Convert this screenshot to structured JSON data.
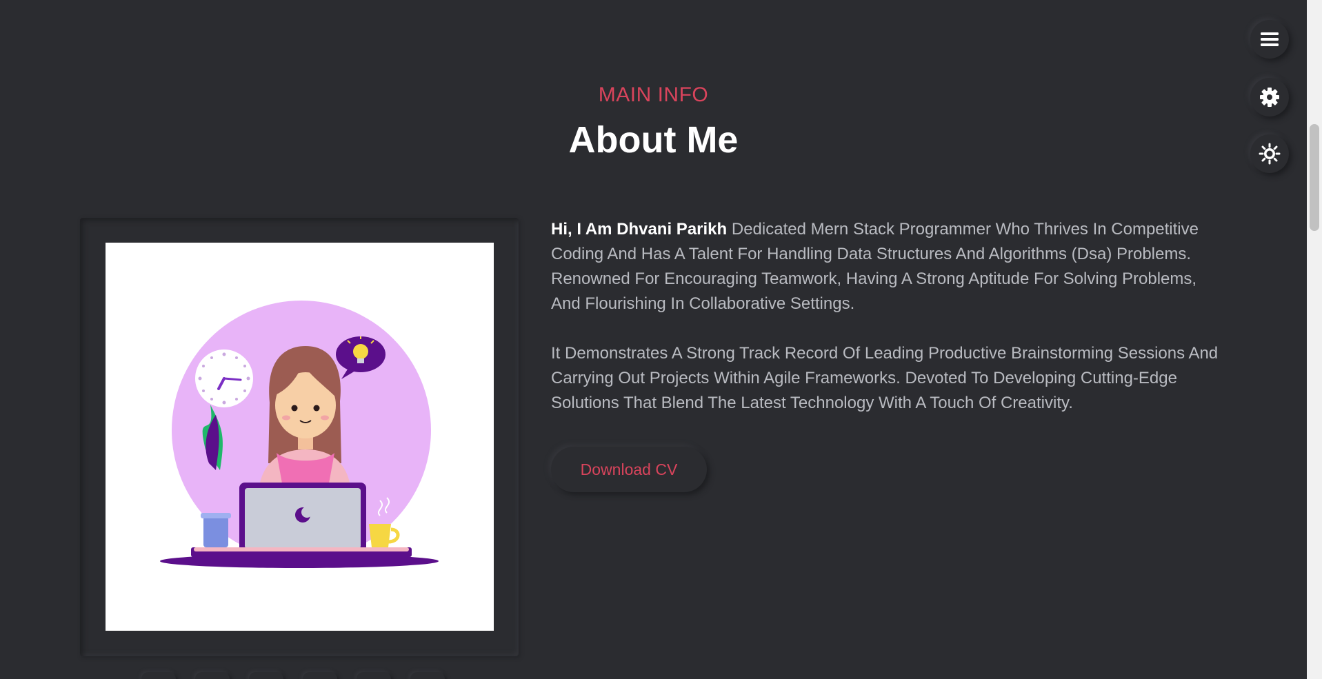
{
  "section": {
    "kicker": "MAIN INFO",
    "title": "About Me"
  },
  "about": {
    "intro_name": "Hi, I Am Dhvani Parikh",
    "intro_text": " Dedicated Mern Stack Programmer Who Thrives In Competitive Coding And Has A Talent For Handling Data Structures And Algorithms (Dsa) Problems. Renowned For Encouraging Teamwork, Having A Strong Aptitude For Solving Problems, And Flourishing In Collaborative Settings.",
    "paragraph2": "It Demonstrates A Strong Track Record Of Leading Productive Brainstorming Sessions And Carrying Out Projects Within Agile Frameworks. Devoted To Developing Cutting-Edge Solutions That Blend The Latest Technology With A Touch Of Creativity.",
    "cv_button": "Download CV"
  },
  "side_controls": {
    "menu_icon": "hamburger-menu-icon",
    "settings_icon": "gear-icon",
    "theme_icon": "sun-icon"
  },
  "colors": {
    "background": "#2b2c30",
    "accent": "#d9445c",
    "text": "#b9bbc1",
    "heading": "#ffffff",
    "illustration_circle": "#e8b4f8",
    "laptop": "#c9ccd8",
    "purple": "#5b0f8b"
  }
}
